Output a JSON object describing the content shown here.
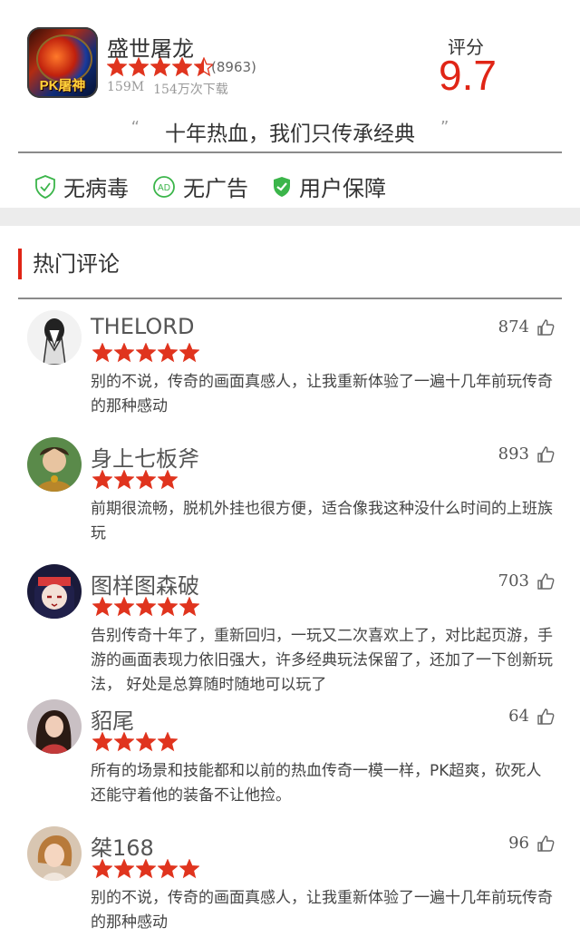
{
  "app": {
    "name": "盛世屠龙",
    "icon_text": "PK屠神",
    "stars": 4.5,
    "rating_count": "(8963)",
    "size": "159M",
    "downloads": "154万次下载",
    "score_label": "评分",
    "score": "9.7"
  },
  "slogan": {
    "open_quote": "“",
    "text": "十年热血，我们只传承经典",
    "close_quote": "”"
  },
  "features": [
    {
      "icon": "shield-outline-icon",
      "label": "无病毒"
    },
    {
      "icon": "ad-circle-icon",
      "label": "无广告"
    },
    {
      "icon": "shield-check-icon",
      "label": "用户保障"
    }
  ],
  "section": {
    "title": "热门评论"
  },
  "comments": [
    {
      "name": "THELORD",
      "stars": 5,
      "likes": "874",
      "avatar_icon": "avatar-hands-icon",
      "text": "别的不说，传奇的画面真感人，让我重新体验了一遍十几年前玩传奇的那种感动"
    },
    {
      "name": "身上七板斧",
      "stars": 4,
      "likes": "893",
      "avatar_icon": "avatar-warrior-icon",
      "text": "前期很流畅，脱机外挂也很方便，适合像我这种没什么时间的上班族玩"
    },
    {
      "name": "图样图森破",
      "stars": 5,
      "likes": "703",
      "avatar_icon": "avatar-ninja-icon",
      "text": "告别传奇十年了，重新回归，一玩又二次喜欢上了，对比起页游，手游的画面表现力依旧强大，许多经典玩法保留了，还加了一下创新玩法， 好处是总算随时随地可以玩了"
    },
    {
      "name": "貂尾",
      "stars": 4,
      "likes": "64",
      "avatar_icon": "avatar-girl-icon",
      "text": "所有的场景和技能都和以前的热血传奇一模一样，PK超爽，砍死人还能守着他的装备不让他捡。"
    },
    {
      "name": "桀168",
      "stars": 5,
      "likes": "96",
      "avatar_icon": "avatar-woman-icon",
      "text": "别的不说，传奇的画面真感人，让我重新体验了一遍十几年前玩传奇的那种感动"
    }
  ],
  "colors": {
    "accent": "#e02516",
    "star": "#e0341e",
    "feature_icon": "#3bb54a"
  }
}
